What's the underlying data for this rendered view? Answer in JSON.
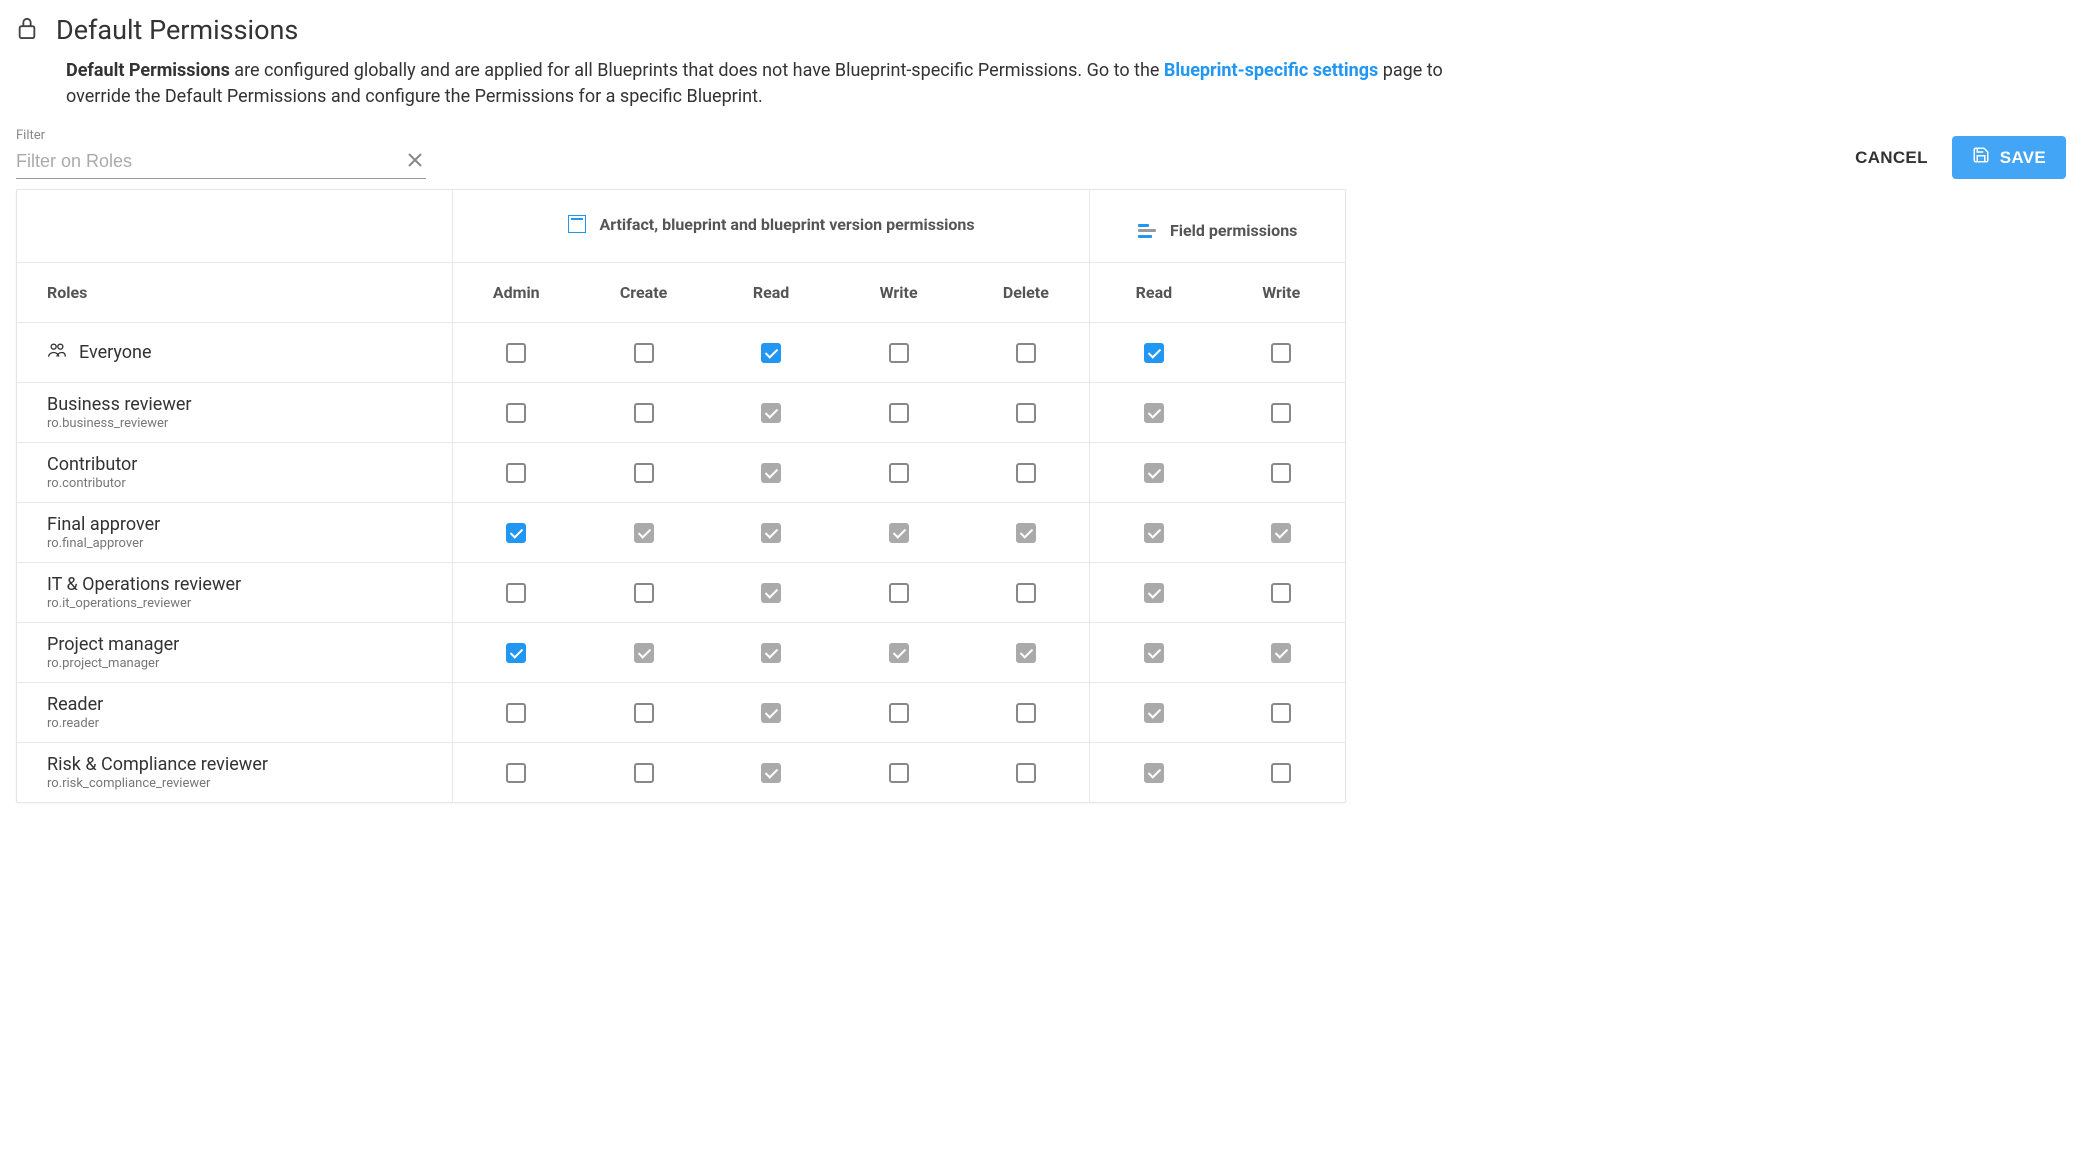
{
  "header": {
    "title": "Default Permissions"
  },
  "description": {
    "bold": "Default Permissions",
    "text1": " are configured globally and are applied for all Blueprints that does not have Blueprint-specific Permissions. Go to the ",
    "link": "Blueprint-specific settings",
    "text2": " page to override the Default Permissions and configure the Permissions for a specific Blueprint."
  },
  "filter": {
    "label": "Filter",
    "placeholder": "Filter on Roles"
  },
  "actions": {
    "cancel": "CANCEL",
    "save": "SAVE"
  },
  "table": {
    "groups": {
      "artifact": "Artifact, blueprint and blueprint version permissions",
      "field": "Field permissions"
    },
    "columns": {
      "roles": "Roles",
      "admin": "Admin",
      "create": "Create",
      "read": "Read",
      "write": "Write",
      "delete": "Delete",
      "field_read": "Read",
      "field_write": "Write"
    },
    "rows": [
      {
        "name": "Everyone",
        "id": "",
        "icon": true,
        "admin": {
          "checked": false,
          "color": ""
        },
        "create": {
          "checked": false,
          "color": ""
        },
        "read": {
          "checked": true,
          "color": "blue"
        },
        "write": {
          "checked": false,
          "color": ""
        },
        "delete": {
          "checked": false,
          "color": ""
        },
        "field_read": {
          "checked": true,
          "color": "blue"
        },
        "field_write": {
          "checked": false,
          "color": ""
        }
      },
      {
        "name": "Business reviewer",
        "id": "ro.business_reviewer",
        "icon": false,
        "admin": {
          "checked": false,
          "color": ""
        },
        "create": {
          "checked": false,
          "color": ""
        },
        "read": {
          "checked": true,
          "color": "grey"
        },
        "write": {
          "checked": false,
          "color": ""
        },
        "delete": {
          "checked": false,
          "color": ""
        },
        "field_read": {
          "checked": true,
          "color": "grey"
        },
        "field_write": {
          "checked": false,
          "color": ""
        }
      },
      {
        "name": "Contributor",
        "id": "ro.contributor",
        "icon": false,
        "admin": {
          "checked": false,
          "color": ""
        },
        "create": {
          "checked": false,
          "color": ""
        },
        "read": {
          "checked": true,
          "color": "grey"
        },
        "write": {
          "checked": false,
          "color": ""
        },
        "delete": {
          "checked": false,
          "color": ""
        },
        "field_read": {
          "checked": true,
          "color": "grey"
        },
        "field_write": {
          "checked": false,
          "color": ""
        }
      },
      {
        "name": "Final approver",
        "id": "ro.final_approver",
        "icon": false,
        "admin": {
          "checked": true,
          "color": "blue"
        },
        "create": {
          "checked": true,
          "color": "grey"
        },
        "read": {
          "checked": true,
          "color": "grey"
        },
        "write": {
          "checked": true,
          "color": "grey"
        },
        "delete": {
          "checked": true,
          "color": "grey"
        },
        "field_read": {
          "checked": true,
          "color": "grey"
        },
        "field_write": {
          "checked": true,
          "color": "grey"
        }
      },
      {
        "name": "IT & Operations reviewer",
        "id": "ro.it_operations_reviewer",
        "icon": false,
        "admin": {
          "checked": false,
          "color": ""
        },
        "create": {
          "checked": false,
          "color": ""
        },
        "read": {
          "checked": true,
          "color": "grey"
        },
        "write": {
          "checked": false,
          "color": ""
        },
        "delete": {
          "checked": false,
          "color": ""
        },
        "field_read": {
          "checked": true,
          "color": "grey"
        },
        "field_write": {
          "checked": false,
          "color": ""
        }
      },
      {
        "name": "Project manager",
        "id": "ro.project_manager",
        "icon": false,
        "admin": {
          "checked": true,
          "color": "blue"
        },
        "create": {
          "checked": true,
          "color": "grey"
        },
        "read": {
          "checked": true,
          "color": "grey"
        },
        "write": {
          "checked": true,
          "color": "grey"
        },
        "delete": {
          "checked": true,
          "color": "grey"
        },
        "field_read": {
          "checked": true,
          "color": "grey"
        },
        "field_write": {
          "checked": true,
          "color": "grey"
        }
      },
      {
        "name": "Reader",
        "id": "ro.reader",
        "icon": false,
        "admin": {
          "checked": false,
          "color": ""
        },
        "create": {
          "checked": false,
          "color": ""
        },
        "read": {
          "checked": true,
          "color": "grey"
        },
        "write": {
          "checked": false,
          "color": ""
        },
        "delete": {
          "checked": false,
          "color": ""
        },
        "field_read": {
          "checked": true,
          "color": "grey"
        },
        "field_write": {
          "checked": false,
          "color": ""
        }
      },
      {
        "name": "Risk & Compliance reviewer",
        "id": "ro.risk_compliance_reviewer",
        "icon": false,
        "admin": {
          "checked": false,
          "color": ""
        },
        "create": {
          "checked": false,
          "color": ""
        },
        "read": {
          "checked": true,
          "color": "grey"
        },
        "write": {
          "checked": false,
          "color": ""
        },
        "delete": {
          "checked": false,
          "color": ""
        },
        "field_read": {
          "checked": true,
          "color": "grey"
        },
        "field_write": {
          "checked": false,
          "color": ""
        }
      }
    ]
  }
}
